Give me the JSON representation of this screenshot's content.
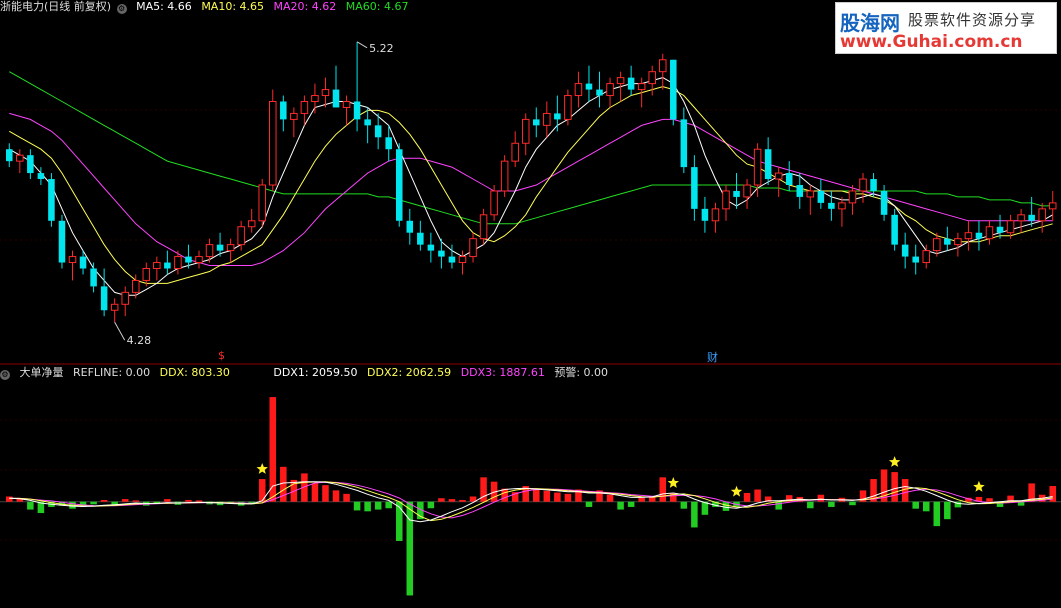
{
  "header": {
    "stock_title": "浙能电力(日线 前复权)",
    "ma5": "MA5: 4.66",
    "ma10": "MA10: 4.65",
    "ma20": "MA20: 4.62",
    "ma60": "MA60: 4.67"
  },
  "colors": {
    "up": "#ff2a2a",
    "down": "#00e5ee",
    "ma5": "#ffffff",
    "ma10": "#ffff55",
    "ma20": "#ff44ff",
    "ma60": "#22dd22",
    "vol_up": "#ff1a1a",
    "vol_down": "#22cc22"
  },
  "annotations": {
    "high_label": "5.22",
    "low_label": "4.28",
    "marker_dollar": "$",
    "marker_cai": "财"
  },
  "indicator": {
    "name": "大单净量",
    "refline": "REFLINE: 0.00",
    "ddx": "DDX: 803.30",
    "ddx1": "DDX1: 2059.50",
    "ddx2": "DDX2: 2062.59",
    "ddx3": "DDX3: 1887.61",
    "warning": "预警: 0.00"
  },
  "logo": {
    "name": "股海网",
    "tagline": "股票软件资源分享",
    "url": "www.Guhai.com.cn"
  },
  "chart_data": [
    {
      "type": "candlestick",
      "ohlc": [
        [
          4.86,
          4.88,
          4.8,
          4.82
        ],
        [
          4.82,
          4.86,
          4.78,
          4.84
        ],
        [
          4.84,
          4.86,
          4.76,
          4.78
        ],
        [
          4.78,
          4.8,
          4.74,
          4.76
        ],
        [
          4.76,
          4.78,
          4.6,
          4.62
        ],
        [
          4.62,
          4.64,
          4.46,
          4.48
        ],
        [
          4.48,
          4.52,
          4.42,
          4.5
        ],
        [
          4.5,
          4.52,
          4.44,
          4.46
        ],
        [
          4.46,
          4.48,
          4.38,
          4.4
        ],
        [
          4.4,
          4.46,
          4.3,
          4.32
        ],
        [
          4.32,
          4.36,
          4.28,
          4.34
        ],
        [
          4.34,
          4.4,
          4.3,
          4.38
        ],
        [
          4.38,
          4.44,
          4.36,
          4.42
        ],
        [
          4.42,
          4.48,
          4.4,
          4.46
        ],
        [
          4.46,
          4.5,
          4.42,
          4.48
        ],
        [
          4.48,
          4.52,
          4.44,
          4.46
        ],
        [
          4.46,
          4.52,
          4.44,
          4.5
        ],
        [
          4.5,
          4.54,
          4.46,
          4.48
        ],
        [
          4.48,
          4.52,
          4.46,
          4.5
        ],
        [
          4.5,
          4.56,
          4.48,
          4.54
        ],
        [
          4.54,
          4.58,
          4.5,
          4.52
        ],
        [
          4.52,
          4.56,
          4.48,
          4.54
        ],
        [
          4.54,
          4.62,
          4.52,
          4.6
        ],
        [
          4.6,
          4.66,
          4.58,
          4.62
        ],
        [
          4.62,
          4.76,
          4.6,
          4.74
        ],
        [
          4.74,
          5.06,
          4.72,
          5.02
        ],
        [
          5.02,
          5.04,
          4.92,
          4.96
        ],
        [
          4.96,
          5.0,
          4.9,
          4.98
        ],
        [
          4.98,
          5.04,
          4.94,
          5.02
        ],
        [
          5.02,
          5.08,
          4.98,
          5.04
        ],
        [
          5.04,
          5.1,
          5.0,
          5.06
        ],
        [
          5.06,
          5.14,
          5.02,
          5.0
        ],
        [
          5.0,
          5.04,
          4.94,
          5.02
        ],
        [
          5.02,
          5.22,
          4.92,
          4.96
        ],
        [
          4.96,
          5.0,
          4.88,
          4.94
        ],
        [
          4.94,
          4.98,
          4.86,
          4.9
        ],
        [
          4.9,
          4.94,
          4.82,
          4.86
        ],
        [
          4.86,
          4.88,
          4.6,
          4.62
        ],
        [
          4.62,
          4.66,
          4.54,
          4.58
        ],
        [
          4.58,
          4.62,
          4.52,
          4.54
        ],
        [
          4.54,
          4.58,
          4.48,
          4.52
        ],
        [
          4.52,
          4.56,
          4.46,
          4.5
        ],
        [
          4.5,
          4.54,
          4.46,
          4.48
        ],
        [
          4.48,
          4.52,
          4.44,
          4.5
        ],
        [
          4.5,
          4.58,
          4.48,
          4.56
        ],
        [
          4.56,
          4.66,
          4.54,
          4.64
        ],
        [
          4.64,
          4.74,
          4.62,
          4.72
        ],
        [
          4.72,
          4.84,
          4.7,
          4.82
        ],
        [
          4.82,
          4.92,
          4.8,
          4.88
        ],
        [
          4.88,
          4.98,
          4.84,
          4.96
        ],
        [
          4.96,
          5.0,
          4.9,
          4.94
        ],
        [
          4.94,
          5.02,
          4.9,
          4.98
        ],
        [
          4.98,
          5.04,
          4.92,
          4.96
        ],
        [
          4.96,
          5.06,
          4.94,
          5.04
        ],
        [
          5.04,
          5.12,
          5.0,
          5.08
        ],
        [
          5.08,
          5.14,
          5.02,
          5.06
        ],
        [
          5.06,
          5.12,
          5.0,
          5.04
        ],
        [
          5.04,
          5.1,
          5.0,
          5.08
        ],
        [
          5.08,
          5.12,
          5.02,
          5.1
        ],
        [
          5.1,
          5.14,
          5.04,
          5.06
        ],
        [
          5.06,
          5.1,
          5.0,
          5.08
        ],
        [
          5.08,
          5.14,
          5.04,
          5.12
        ],
        [
          5.12,
          5.18,
          5.06,
          5.16
        ],
        [
          5.16,
          5.16,
          4.94,
          4.96
        ],
        [
          4.96,
          5.0,
          4.78,
          4.8
        ],
        [
          4.8,
          4.84,
          4.62,
          4.66
        ],
        [
          4.66,
          4.7,
          4.58,
          4.62
        ],
        [
          4.62,
          4.68,
          4.58,
          4.66
        ],
        [
          4.66,
          4.74,
          4.62,
          4.72
        ],
        [
          4.72,
          4.78,
          4.66,
          4.7
        ],
        [
          4.7,
          4.76,
          4.66,
          4.74
        ],
        [
          4.74,
          4.88,
          4.7,
          4.86
        ],
        [
          4.86,
          4.9,
          4.74,
          4.76
        ],
        [
          4.76,
          4.8,
          4.7,
          4.78
        ],
        [
          4.78,
          4.82,
          4.72,
          4.74
        ],
        [
          4.74,
          4.78,
          4.66,
          4.7
        ],
        [
          4.7,
          4.74,
          4.64,
          4.72
        ],
        [
          4.72,
          4.76,
          4.66,
          4.68
        ],
        [
          4.68,
          4.72,
          4.62,
          4.66
        ],
        [
          4.66,
          4.7,
          4.6,
          4.68
        ],
        [
          4.68,
          4.74,
          4.64,
          4.72
        ],
        [
          4.72,
          4.78,
          4.68,
          4.76
        ],
        [
          4.76,
          4.78,
          4.7,
          4.72
        ],
        [
          4.72,
          4.74,
          4.62,
          4.64
        ],
        [
          4.64,
          4.66,
          4.52,
          4.54
        ],
        [
          4.54,
          4.58,
          4.46,
          4.5
        ],
        [
          4.5,
          4.54,
          4.44,
          4.48
        ],
        [
          4.48,
          4.54,
          4.46,
          4.52
        ],
        [
          4.52,
          4.58,
          4.5,
          4.56
        ],
        [
          4.56,
          4.6,
          4.52,
          4.54
        ],
        [
          4.54,
          4.58,
          4.5,
          4.56
        ],
        [
          4.56,
          4.62,
          4.52,
          4.58
        ],
        [
          4.58,
          4.62,
          4.52,
          4.56
        ],
        [
          4.56,
          4.62,
          4.54,
          4.6
        ],
        [
          4.6,
          4.64,
          4.56,
          4.58
        ],
        [
          4.58,
          4.64,
          4.56,
          4.62
        ],
        [
          4.62,
          4.66,
          4.58,
          4.64
        ],
        [
          4.64,
          4.7,
          4.6,
          4.62
        ],
        [
          4.62,
          4.68,
          4.58,
          4.66
        ],
        [
          4.66,
          4.72,
          4.62,
          4.68
        ]
      ],
      "ma5": [
        4.86,
        4.84,
        4.82,
        4.78,
        4.74,
        4.66,
        4.58,
        4.52,
        4.46,
        4.42,
        4.38,
        4.37,
        4.37,
        4.39,
        4.41,
        4.44,
        4.46,
        4.47,
        4.48,
        4.49,
        4.51,
        4.52,
        4.54,
        4.56,
        4.6,
        4.7,
        4.78,
        4.86,
        4.94,
        5.0,
        5.01,
        5.02,
        5.02,
        5.01,
        5.0,
        4.97,
        4.94,
        4.86,
        4.78,
        4.7,
        4.62,
        4.55,
        4.52,
        4.5,
        4.52,
        4.54,
        4.58,
        4.65,
        4.72,
        4.8,
        4.86,
        4.9,
        4.94,
        4.96,
        4.99,
        5.02,
        5.04,
        5.06,
        5.07,
        5.08,
        5.08,
        5.09,
        5.1,
        5.08,
        5.02,
        4.94,
        4.84,
        4.76,
        4.69,
        4.67,
        4.69,
        4.73,
        4.75,
        4.77,
        4.78,
        4.77,
        4.74,
        4.72,
        4.7,
        4.69,
        4.69,
        4.7,
        4.71,
        4.7,
        4.67,
        4.62,
        4.57,
        4.52,
        4.51,
        4.52,
        4.53,
        4.55,
        4.56,
        4.57,
        4.58,
        4.59,
        4.6,
        4.61,
        4.62,
        4.64
      ],
      "ma10": [
        4.92,
        4.9,
        4.88,
        4.86,
        4.83,
        4.78,
        4.72,
        4.66,
        4.6,
        4.54,
        4.49,
        4.45,
        4.42,
        4.41,
        4.41,
        4.41,
        4.42,
        4.43,
        4.44,
        4.45,
        4.47,
        4.48,
        4.5,
        4.52,
        4.54,
        4.59,
        4.64,
        4.7,
        4.76,
        4.82,
        4.87,
        4.91,
        4.94,
        4.97,
        4.99,
        4.99,
        4.98,
        4.95,
        4.91,
        4.86,
        4.8,
        4.74,
        4.68,
        4.62,
        4.58,
        4.56,
        4.55,
        4.57,
        4.6,
        4.64,
        4.7,
        4.75,
        4.8,
        4.85,
        4.89,
        4.93,
        4.97,
        5.0,
        5.02,
        5.04,
        5.05,
        5.06,
        5.07,
        5.06,
        5.04,
        5.0,
        4.96,
        4.92,
        4.88,
        4.84,
        4.81,
        4.8,
        4.78,
        4.76,
        4.74,
        4.73,
        4.72,
        4.72,
        4.72,
        4.72,
        4.71,
        4.71,
        4.7,
        4.69,
        4.67,
        4.64,
        4.62,
        4.59,
        4.57,
        4.56,
        4.55,
        4.55,
        4.55,
        4.56,
        4.57,
        4.57,
        4.58,
        4.59,
        4.6,
        4.61
      ],
      "ma20": [
        4.98,
        4.97,
        4.96,
        4.94,
        4.92,
        4.89,
        4.85,
        4.81,
        4.77,
        4.73,
        4.69,
        4.65,
        4.61,
        4.58,
        4.55,
        4.53,
        4.51,
        4.49,
        4.48,
        4.47,
        4.47,
        4.47,
        4.47,
        4.47,
        4.48,
        4.5,
        4.52,
        4.55,
        4.58,
        4.62,
        4.66,
        4.69,
        4.72,
        4.75,
        4.78,
        4.8,
        4.82,
        4.83,
        4.83,
        4.83,
        4.82,
        4.81,
        4.8,
        4.78,
        4.76,
        4.74,
        4.72,
        4.72,
        4.72,
        4.73,
        4.74,
        4.76,
        4.78,
        4.8,
        4.82,
        4.84,
        4.86,
        4.88,
        4.9,
        4.92,
        4.94,
        4.95,
        4.96,
        4.96,
        4.95,
        4.94,
        4.92,
        4.9,
        4.88,
        4.86,
        4.84,
        4.82,
        4.81,
        4.8,
        4.79,
        4.78,
        4.77,
        4.76,
        4.75,
        4.74,
        4.73,
        4.72,
        4.71,
        4.7,
        4.69,
        4.68,
        4.67,
        4.66,
        4.65,
        4.64,
        4.63,
        4.62,
        4.62,
        4.62,
        4.62,
        4.62,
        4.62,
        4.62,
        4.62,
        4.62
      ],
      "ma60": [
        5.12,
        5.1,
        5.08,
        5.06,
        5.04,
        5.02,
        5.0,
        4.98,
        4.96,
        4.94,
        4.92,
        4.9,
        4.88,
        4.86,
        4.84,
        4.82,
        4.81,
        4.8,
        4.79,
        4.78,
        4.77,
        4.76,
        4.75,
        4.74,
        4.73,
        4.72,
        4.71,
        4.71,
        4.71,
        4.71,
        4.71,
        4.71,
        4.71,
        4.71,
        4.71,
        4.7,
        4.7,
        4.69,
        4.68,
        4.67,
        4.66,
        4.65,
        4.64,
        4.63,
        4.62,
        4.61,
        4.61,
        4.61,
        4.61,
        4.62,
        4.63,
        4.64,
        4.65,
        4.66,
        4.67,
        4.68,
        4.69,
        4.7,
        4.71,
        4.72,
        4.73,
        4.74,
        4.74,
        4.74,
        4.74,
        4.74,
        4.74,
        4.74,
        4.74,
        4.74,
        4.74,
        4.73,
        4.73,
        4.73,
        4.72,
        4.72,
        4.72,
        4.72,
        4.72,
        4.72,
        4.72,
        4.72,
        4.72,
        4.72,
        4.72,
        4.72,
        4.72,
        4.71,
        4.71,
        4.71,
        4.7,
        4.7,
        4.7,
        4.69,
        4.69,
        4.69,
        4.68,
        4.68,
        4.67,
        4.67
      ],
      "ylim": [
        4.18,
        5.3
      ],
      "high_point": {
        "index": 33,
        "value": 5.22
      },
      "low_point": {
        "index": 10,
        "value": 4.28
      }
    },
    {
      "type": "bar",
      "values": [
        120,
        80,
        -180,
        -260,
        -120,
        -90,
        -160,
        -120,
        -60,
        40,
        -80,
        60,
        30,
        -90,
        -40,
        60,
        -70,
        40,
        30,
        -60,
        -80,
        -40,
        -90,
        -60,
        520,
        2400,
        800,
        500,
        650,
        420,
        380,
        260,
        180,
        -200,
        -220,
        -180,
        -150,
        -900,
        -2150,
        -400,
        -150,
        80,
        60,
        40,
        120,
        560,
        460,
        300,
        220,
        360,
        300,
        250,
        210,
        180,
        280,
        -120,
        260,
        160,
        -180,
        -120,
        90,
        120,
        560,
        200,
        -160,
        -590,
        -300,
        -120,
        -210,
        -110,
        200,
        280,
        120,
        -180,
        150,
        110,
        -150,
        160,
        -120,
        90,
        -80,
        260,
        520,
        740,
        680,
        520,
        -160,
        -220,
        -560,
        -400,
        -130,
        90,
        110,
        80,
        -120,
        140,
        -90,
        420,
        160,
        360
      ],
      "ddx": [
        80,
        70,
        30,
        -30,
        -60,
        -80,
        -100,
        -110,
        -100,
        -80,
        -70,
        -50,
        -30,
        -40,
        -40,
        -20,
        -30,
        -20,
        -10,
        -20,
        -30,
        -40,
        -50,
        -50,
        20,
        360,
        430,
        440,
        460,
        460,
        450,
        400,
        330,
        260,
        170,
        90,
        30,
        -120,
        -420,
        -460,
        -420,
        -330,
        -230,
        -140,
        -20,
        120,
        220,
        280,
        300,
        310,
        290,
        270,
        250,
        230,
        230,
        200,
        200,
        180,
        140,
        100,
        100,
        110,
        180,
        200,
        160,
        60,
        -20,
        -80,
        -130,
        -150,
        -100,
        -30,
        20,
        20,
        40,
        60,
        40,
        60,
        40,
        40,
        30,
        60,
        130,
        220,
        300,
        350,
        310,
        240,
        140,
        40,
        -40,
        -60,
        -40,
        -20,
        0,
        20,
        20,
        60,
        80,
        120
      ],
      "stars": [
        24,
        63,
        69,
        84,
        92
      ],
      "ylim": [
        -2300,
        2700
      ]
    }
  ]
}
